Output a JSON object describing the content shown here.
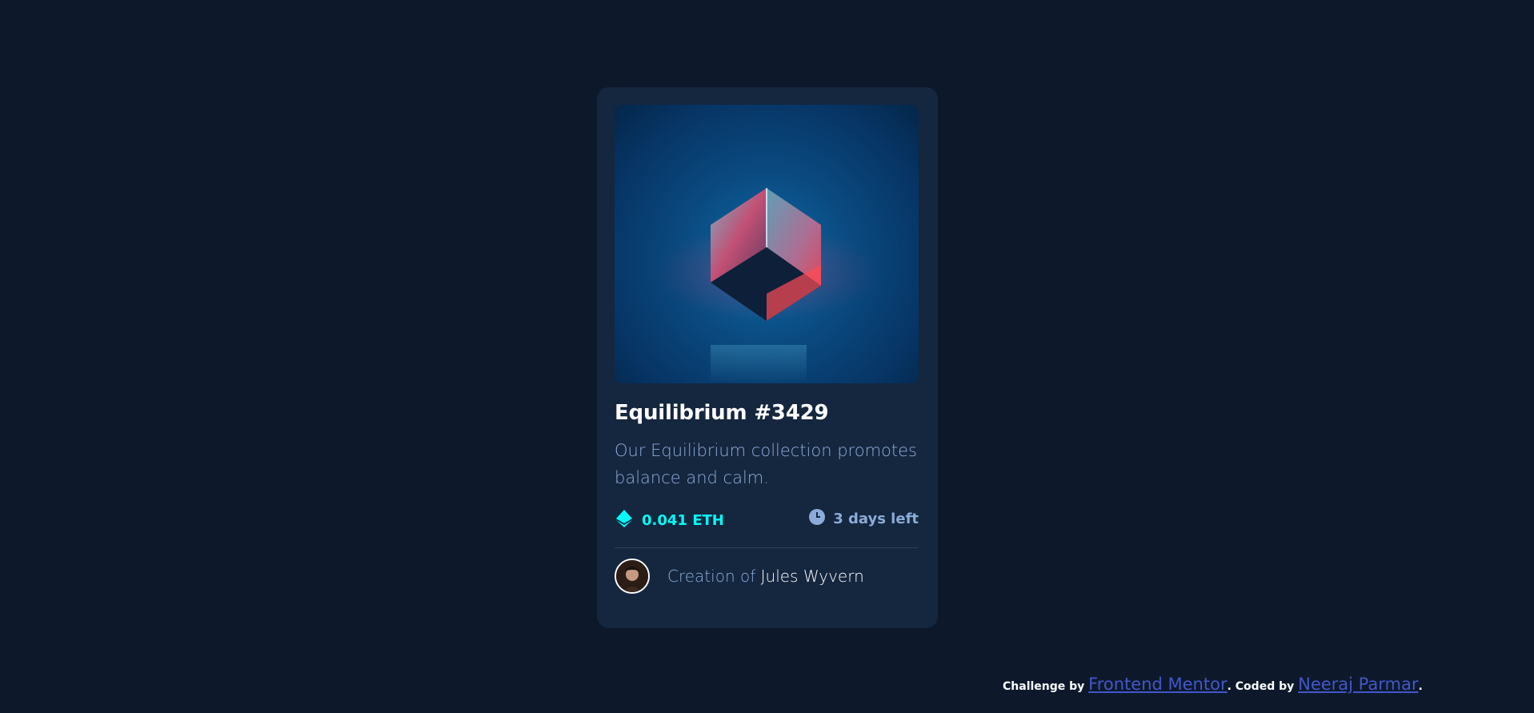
{
  "card": {
    "title": "Equilibrium #3429",
    "description": "Our Equilibrium collection promotes balance and calm.",
    "price": "0.041 ETH",
    "time_left": "3 days left",
    "creator_prefix": "Creation of ",
    "creator_name": "Jules Wyvern"
  },
  "footer": {
    "challenge_prefix": "Challenge by ",
    "challenge_link": "Frontend Mentor",
    "coded_prefix": ". Coded by ",
    "coded_link": "Neeraj Parmar",
    "suffix": "."
  },
  "icons": {
    "price": "ethereum-icon",
    "time": "clock-icon"
  },
  "colors": {
    "background": "#0d192b",
    "card": "#15263f",
    "cyan": "#00fff8",
    "soft_blue": "#8bacd9",
    "link": "#4257c9",
    "white": "#ffffff"
  }
}
